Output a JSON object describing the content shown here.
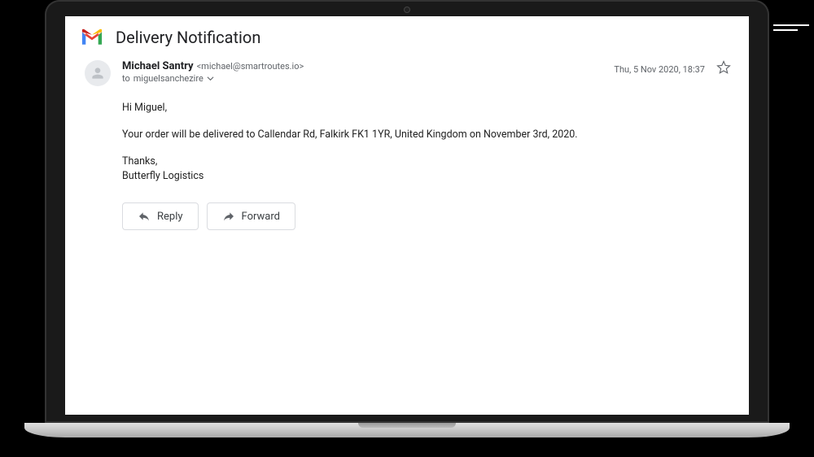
{
  "subject": "Delivery Notification",
  "sender": {
    "name": "Michael Santry",
    "email": "<michael@smartroutes.io>"
  },
  "recipient": {
    "prefix": "to",
    "name": "miguelsanchezire"
  },
  "timestamp": "Thu, 5 Nov 2020, 18:37",
  "body": {
    "greeting": "Hi Miguel,",
    "message": "Your order will be delivered to Callendar Rd, Falkirk FK1 1YR, United Kingdom on November 3rd, 2020.",
    "thanks": "Thanks,",
    "signature": "Butterfly Logistics"
  },
  "actions": {
    "reply": "Reply",
    "forward": "Forward"
  }
}
